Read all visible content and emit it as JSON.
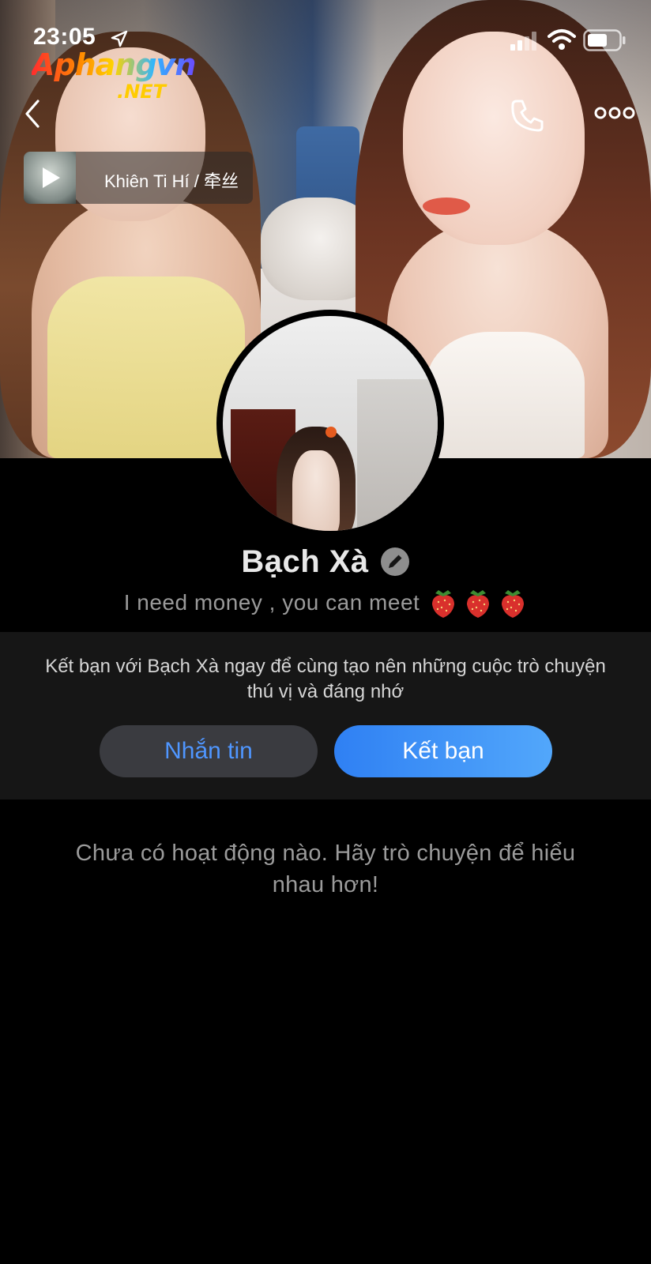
{
  "status_bar": {
    "time": "23:05"
  },
  "watermark": {
    "brand": "Aphangvn",
    "suffix": ".NET"
  },
  "header": {
    "back_icon": "chevron-left-icon",
    "call_icon": "phone-icon",
    "more_icon": "ellipsis-icon"
  },
  "music": {
    "title": "Khiên Ti Hí / 牵丝"
  },
  "profile": {
    "name": "Bạch Xà",
    "bio": "I need money , you can meet",
    "bio_emoji_count": 3
  },
  "friend_card": {
    "prompt": "Kết bạn với Bạch Xà ngay để cùng tạo nên những cuộc trò chuyện thú vị và đáng nhớ",
    "message_label": "Nhắn tin",
    "add_friend_label": "Kết bạn"
  },
  "activity": {
    "empty_text": "Chưa có hoạt động nào. Hãy trò chuyện để hiểu nhau hơn!"
  },
  "colors": {
    "background": "#000000",
    "card": "#161616",
    "accent_blue": "#2f80f3",
    "secondary_button": "#3a3b40"
  }
}
